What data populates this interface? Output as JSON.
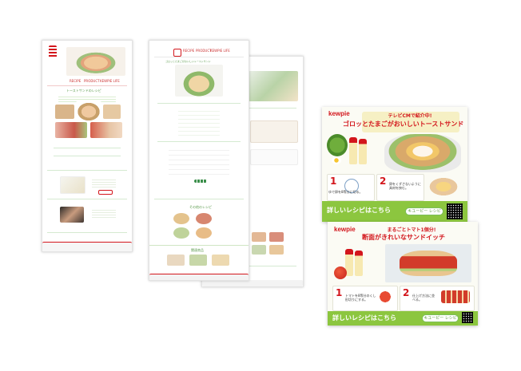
{
  "card1": {
    "brand": "kewpie",
    "banner_top": "テレビCMで紹介中!",
    "headline": "ゴロッとたまごがおいしいトーストサンド",
    "step1_number": "1",
    "step1_text": "ゆで卵を8等分に切る。",
    "step2_number": "2",
    "step2_text": "卵をくずさないように具材を挟む。",
    "footer": "詳しいレシピはこちら",
    "search_label": "キユーピー レシピ"
  },
  "card2": {
    "brand": "kewpie",
    "banner_top": "まるごとトマト1個分!",
    "headline": "断面がきれいなサンドイッチ",
    "step1_number": "1",
    "step1_text": "トマトを8等分のくし形切りにする。",
    "step2_number": "2",
    "step2_text": "仕上げ方法に並べる。",
    "footer": "詳しいレシピはこちら",
    "search_label": "キユーピー レシピ"
  },
  "web": {
    "nav": [
      "RECIPE",
      "PRODUCT",
      "KEWPIE LIFE"
    ],
    "page1_title": "トーストサンドのレシピ",
    "page2_title": "ゴロッとたまごがおいしいトーストサンド",
    "more_recipes": "その他のレシピ",
    "related": "関連商品"
  },
  "colors": {
    "brand_red": "#d3161c",
    "accent_green": "#8cc63f",
    "banner_bg": "#f2f8ec"
  }
}
